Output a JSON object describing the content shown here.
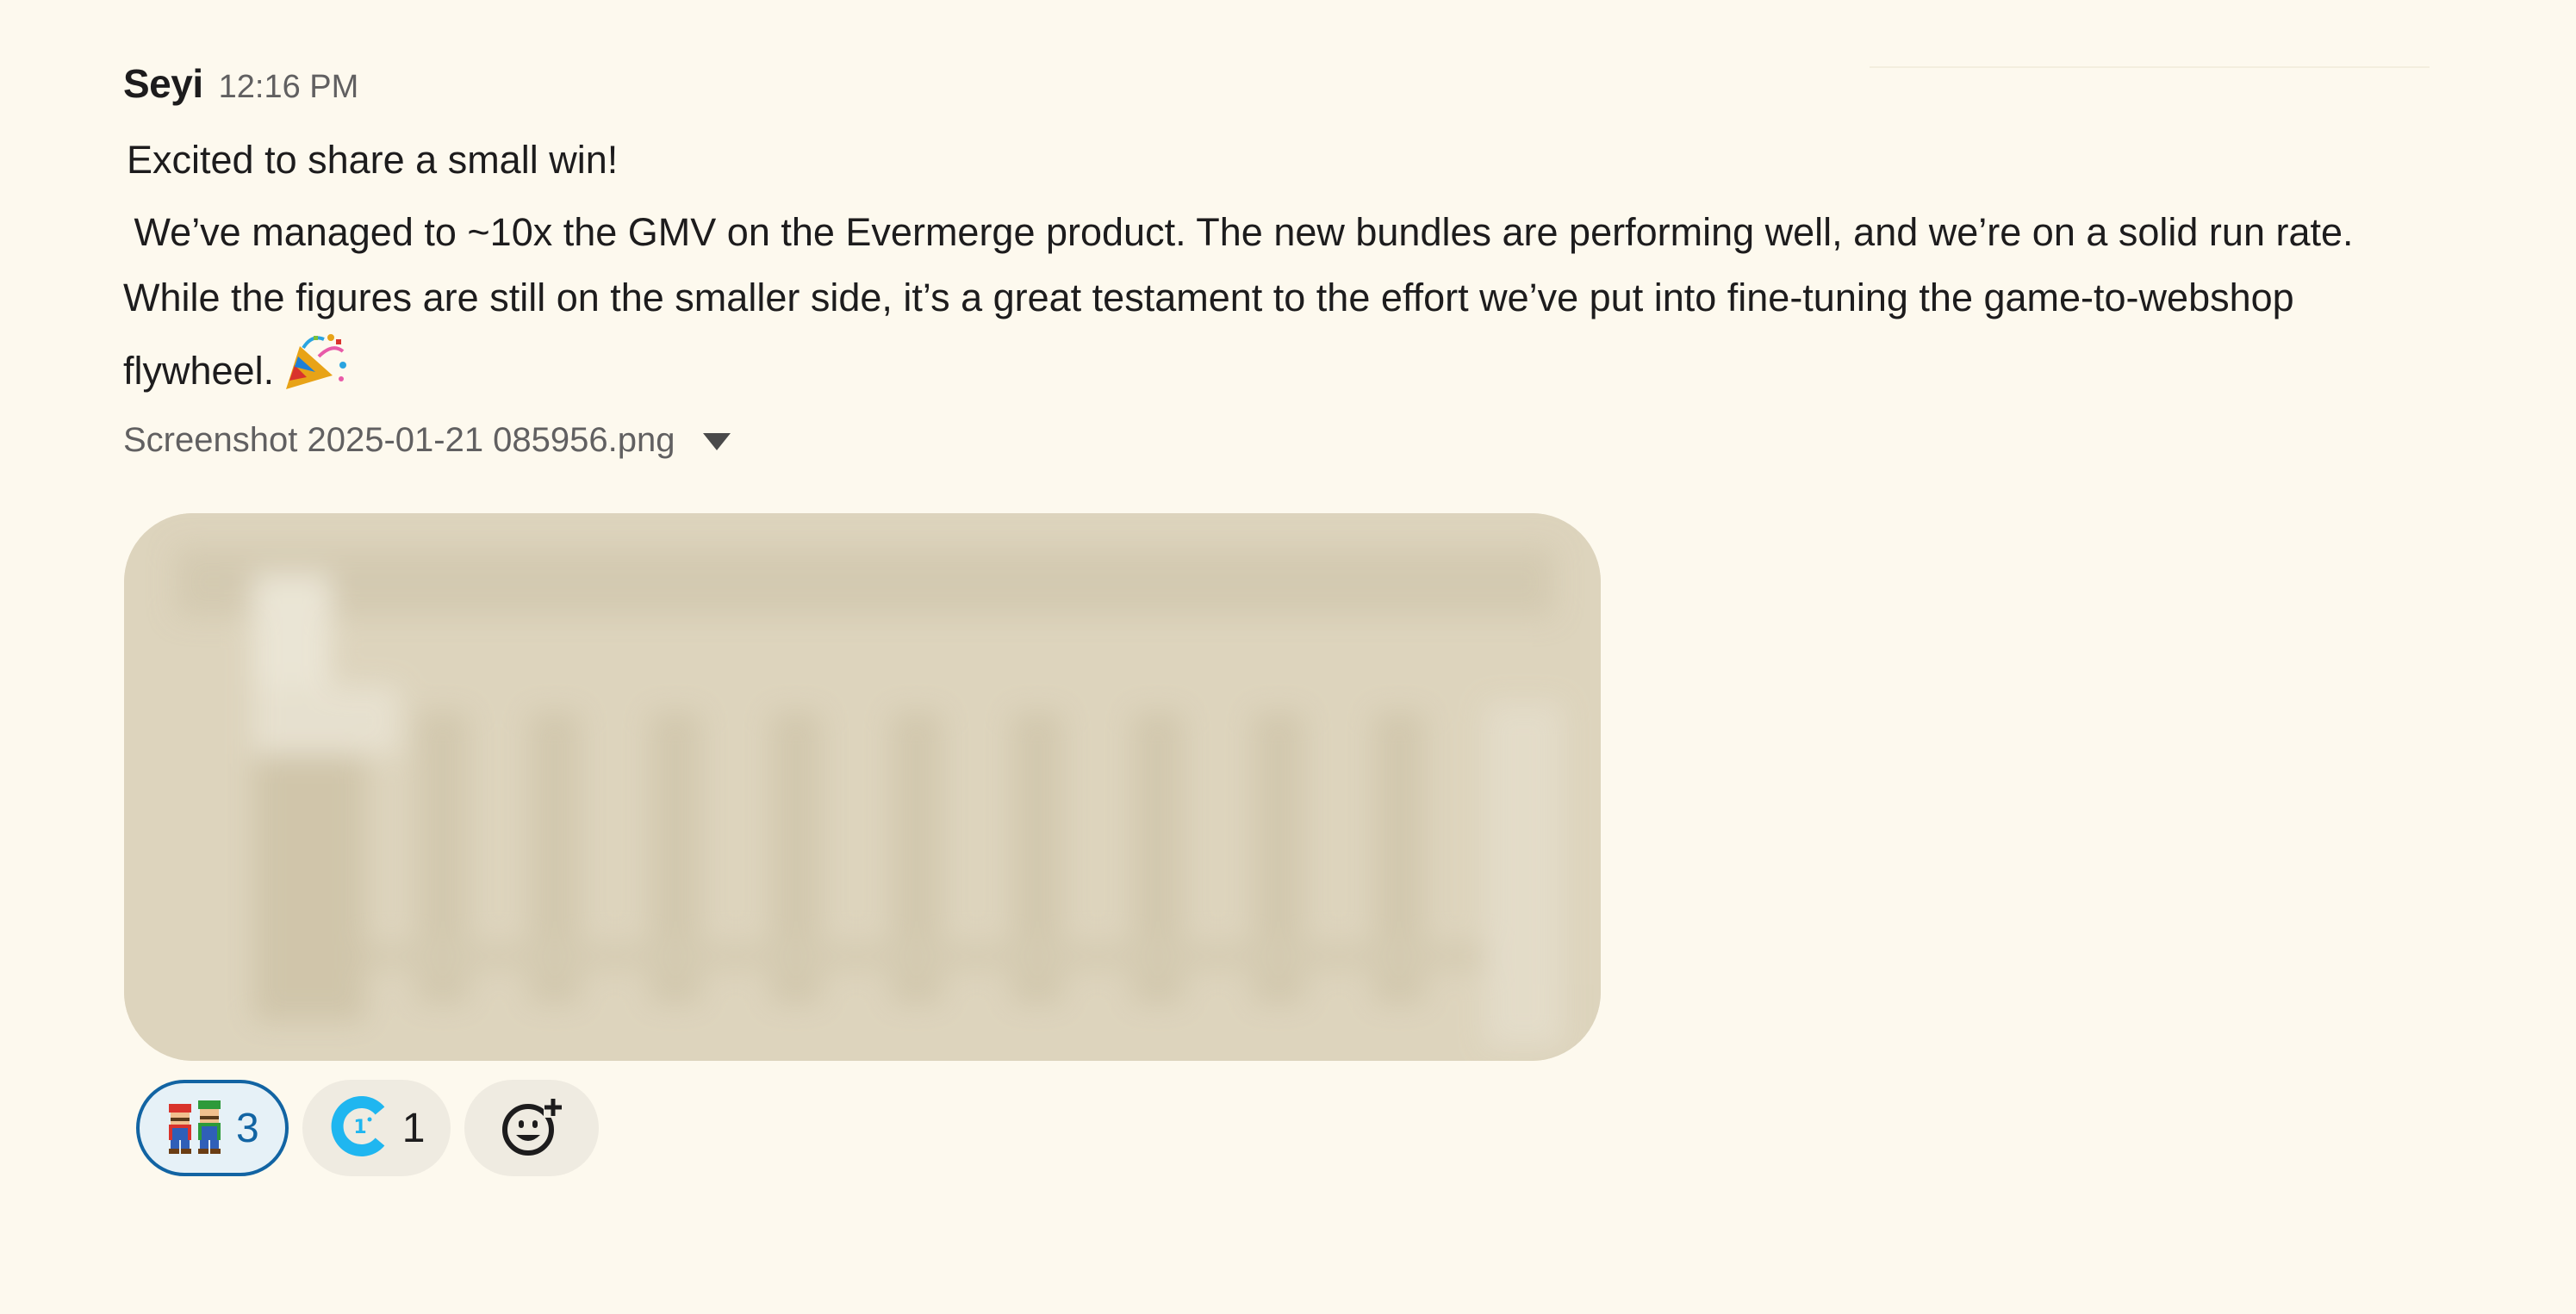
{
  "message": {
    "sender": "Seyi",
    "timestamp": "12:16 PM",
    "line1": "Excited to share a small win!",
    "body": " We’ve managed to ~10x the GMV on the Evermerge product. The new bundles are performing well, and we’re on a solid run rate. While the figures are still on the smaller side, it’s a great testament to the effort we’ve put into fine-tuning the game-to-webshop flywheel.",
    "body_emoji": "party-popper-icon"
  },
  "attachment": {
    "file_name": "Screenshot 2025-01-21 085956.png",
    "caret_icon": "caret-down-icon",
    "preview": "blurred-image"
  },
  "reactions": [
    {
      "icon": "mario-luigi-icon",
      "count": "3",
      "active": true
    },
    {
      "icon": "c-logo-icon",
      "count": "1",
      "active": false
    }
  ],
  "add_reaction_icon": "add-reaction-icon",
  "colors": {
    "background": "#fdf9ee",
    "active_reaction_border": "#1264a3",
    "active_reaction_bg": "#e6f1f7",
    "reaction_bg": "#efebe1",
    "attachment_bg": "#ddd4bd"
  }
}
